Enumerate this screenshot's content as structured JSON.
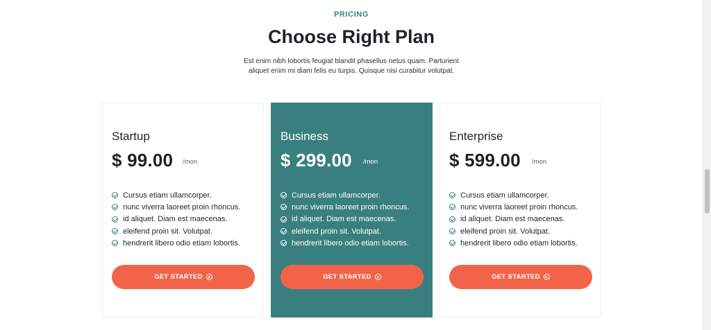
{
  "header": {
    "eyebrow": "PRICING",
    "title": "Choose Right Plan",
    "subtitle": "Est enim nibh lobortis feugiat blandit phasellus netus quam. Parturient aliquet enim mi diam felis eu turpis. Quisque nisi curabitur volutpat."
  },
  "plans": [
    {
      "name": "Startup",
      "price": "$ 99.00",
      "period": "/mon",
      "features": [
        "Cursus etiam ullamcorper.",
        "nunc viverra laoreet proin rhoncus.",
        "id aliquet. Diam est maecenas.",
        "eleifend proin sit. Volutpat.",
        "hendrerit libero odio etiam lobortis."
      ],
      "cta": "GET STARTED"
    },
    {
      "name": "Business",
      "price": "$ 299.00",
      "period": "/mon",
      "features": [
        "Cursus etiam ullamcorper.",
        "nunc viverra laoreet proin rhoncus.",
        "id aliquet. Diam est maecenas.",
        "eleifend proin sit. Volutpat.",
        "hendrerit libero odio etiam lobortis."
      ],
      "cta": "GET STARTED",
      "highlighted": true
    },
    {
      "name": "Enterprise",
      "price": "$ 599.00",
      "period": "/mon",
      "features": [
        "Cursus etiam ullamcorper.",
        "nunc viverra laoreet proin rhoncus.",
        "id aliquet. Diam est maecenas.",
        "eleifend proin sit. Volutpat.",
        "hendrerit libero odio etiam lobortis."
      ],
      "cta": "GET STARTED"
    }
  ],
  "icons": {
    "feature_check": "check-circle-icon",
    "cta_arrow": "arrow-circle-right-icon"
  },
  "colors": {
    "accent": "#3a7f80",
    "cta": "#f2644a",
    "text": "#1e2326"
  }
}
